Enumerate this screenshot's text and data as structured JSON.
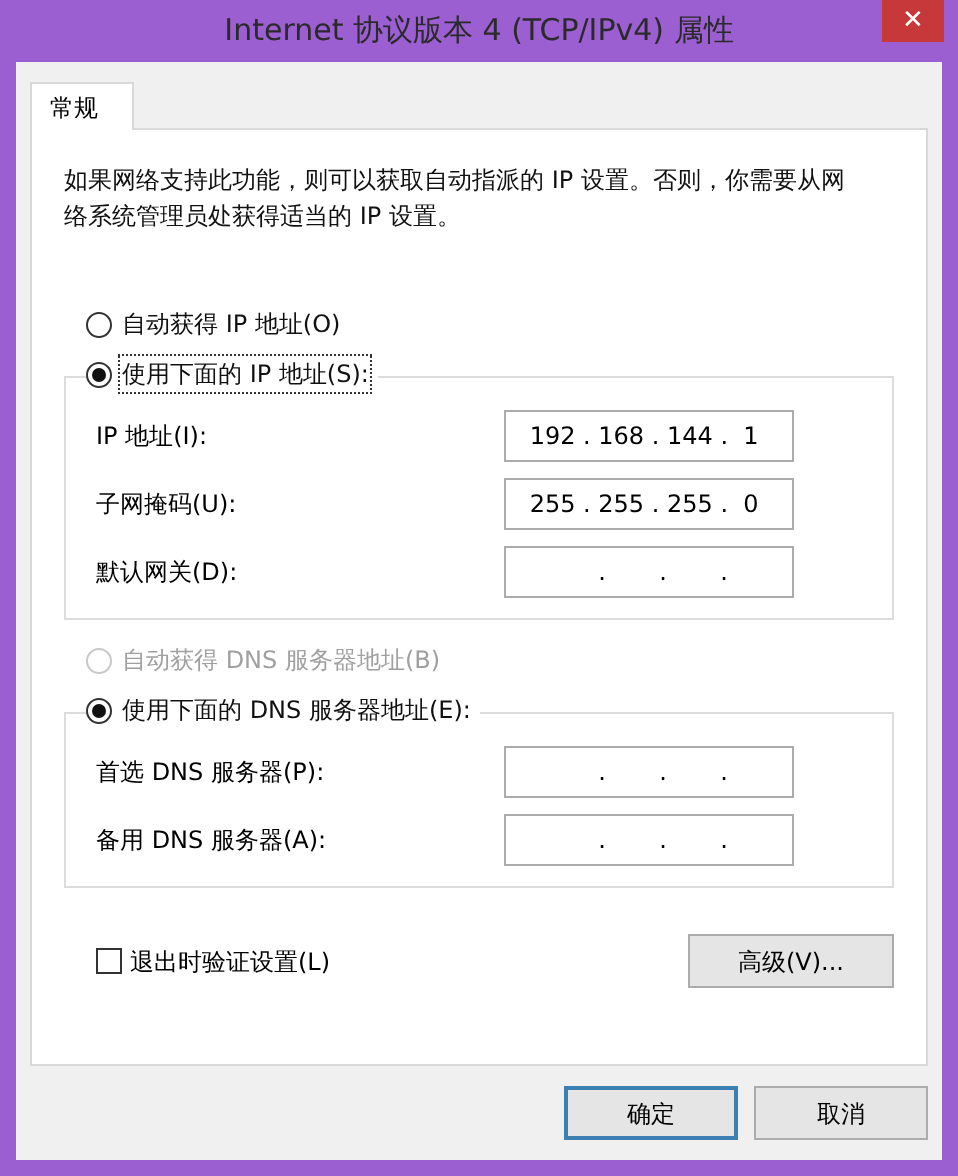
{
  "window": {
    "title": "Internet 协议版本 4 (TCP/IPv4) 属性",
    "close": "✕"
  },
  "tabs": [
    {
      "label": "常规",
      "selected": true
    }
  ],
  "description": "如果网络支持此功能，则可以获取自动指派的 IP 设置。否则，你需要从网络系统管理员处获得适当的 IP 设置。",
  "ip_section": {
    "auto": {
      "label": "自动获得 IP 地址(O)",
      "selected": false,
      "disabled": false
    },
    "manual": {
      "label": "使用下面的 IP 地址(S):",
      "selected": true,
      "focused": true
    },
    "fields": [
      {
        "label": "IP 地址(I):",
        "value": " 192 . 168 . 144 .  1"
      },
      {
        "label": "子网掩码(U):",
        "value": " 255 . 255 . 255 .  0"
      },
      {
        "label": "默认网关(D):",
        "value": "          .       .       ."
      }
    ]
  },
  "dns_section": {
    "auto": {
      "label": "自动获得 DNS 服务器地址(B)",
      "selected": false,
      "disabled": true
    },
    "manual": {
      "label": "使用下面的 DNS 服务器地址(E):",
      "selected": true,
      "focused": false
    },
    "fields": [
      {
        "label": "首选 DNS 服务器(P):",
        "value": "          .       .       ."
      },
      {
        "label": "备用 DNS 服务器(A):",
        "value": "          .       .       ."
      }
    ]
  },
  "validate": {
    "label": "退出时验证设置(L)",
    "checked": false
  },
  "advanced_button": "高级(V)...",
  "buttons": [
    {
      "label": "确定",
      "default": true
    },
    {
      "label": "取消",
      "default": false
    }
  ]
}
